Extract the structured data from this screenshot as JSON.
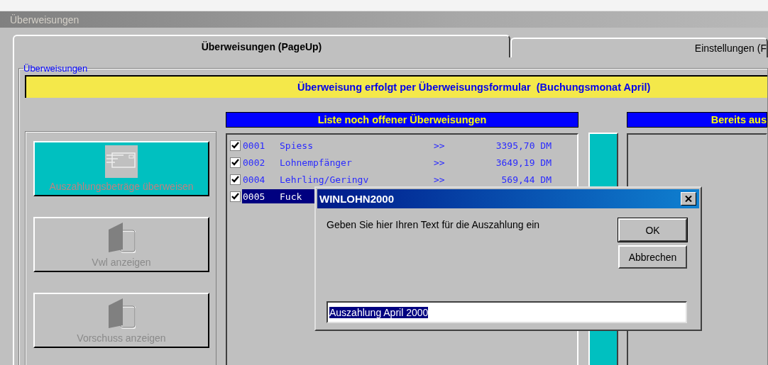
{
  "window": {
    "title": "Überweisungen"
  },
  "tabs": [
    {
      "label": "Überweisungen (PageUp)",
      "selected": true
    },
    {
      "label": "Einstellungen (F",
      "selected": false
    }
  ],
  "group": {
    "label": "Überweisungen"
  },
  "banner": "Überweisung erfolgt per Überweisungsformular  (Buchungsmonat April)",
  "actions": [
    {
      "label": "Auszahlungsbeträge überweisen",
      "kind": "form",
      "highlighted": true,
      "disabled": true
    },
    {
      "label": "Vwl anzeigen",
      "kind": "book",
      "highlighted": false,
      "disabled": true
    },
    {
      "label": "Vorschuss anzeigen",
      "kind": "book",
      "highlighted": false,
      "disabled": true
    }
  ],
  "open_list": {
    "title": "Liste noch offener Überweisungen",
    "rows": [
      {
        "number": "0001",
        "name": "Spiess",
        "arrow": ">>",
        "amount": "3395,70 DM",
        "checked": true,
        "selected": false
      },
      {
        "number": "0002",
        "name": "Lohnempfänger",
        "arrow": ">>",
        "amount": "3649,19 DM",
        "checked": true,
        "selected": false
      },
      {
        "number": "0004",
        "name": "Lehrling/Geringv",
        "arrow": ">>",
        "amount": "569,44 DM",
        "checked": true,
        "selected": false
      },
      {
        "number": "0005",
        "name": "Fuck",
        "checked": true,
        "selected": true
      }
    ]
  },
  "done_list": {
    "title": "Bereits aus"
  },
  "dialog": {
    "title": "WINLOHN2000",
    "prompt": "Geben Sie hier Ihren Text für die Auszahlung ein",
    "buttons": [
      "OK",
      "Abbrechen"
    ],
    "field": {
      "value": "Auszahlung April 2000",
      "selected": true
    }
  }
}
